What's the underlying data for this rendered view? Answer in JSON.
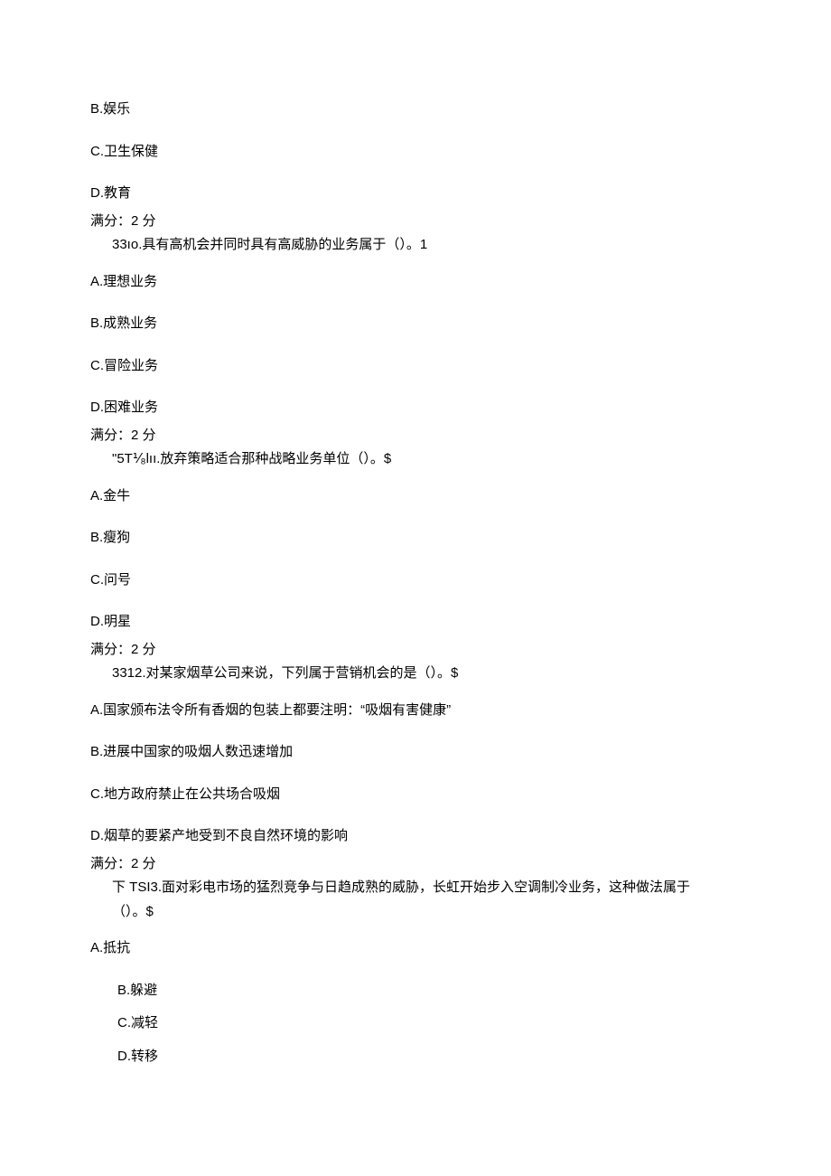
{
  "topOptions": {
    "b": "B.娱乐",
    "c": "C.卫生保健",
    "d": "D.教育"
  },
  "score_label": "满分：2 分",
  "q10": {
    "stem": "33ıo.具有高机会并同时具有高威胁的业务属于（）。1",
    "a": "A.理想业务",
    "b": "B.成熟业务",
    "c": "C.冒险业务",
    "d": "D.困难业务"
  },
  "q11": {
    "stem": "\"5T⅟₈lıı.放弃策略适合那种战略业务单位（）。$",
    "a": "A.金牛",
    "b": "B.瘦狗",
    "c": "C.问号",
    "d": "D.明星"
  },
  "q12": {
    "stem": "3312.对某家烟草公司来说，下列属于营销机会的是（）。$",
    "a": "A.国家颁布法令所有香烟的包装上都要注明：“吸烟有害健康”",
    "b": "B.进展中国家的吸烟人数迅速增加",
    "c": "C.地方政府禁止在公共场合吸烟",
    "d": "D.烟草的要紧产地受到不良自然环境的影响"
  },
  "q13": {
    "stem_line1": "下 TSI3.面对彩电市场的猛烈竞争与日趋成熟的威胁，长虹开始步入空调制冷业务，这种做法属于",
    "stem_line2": "（）。$",
    "a": "A.抵抗",
    "b": "B.躲避",
    "c": "C.减轻",
    "d": "D.转移"
  }
}
